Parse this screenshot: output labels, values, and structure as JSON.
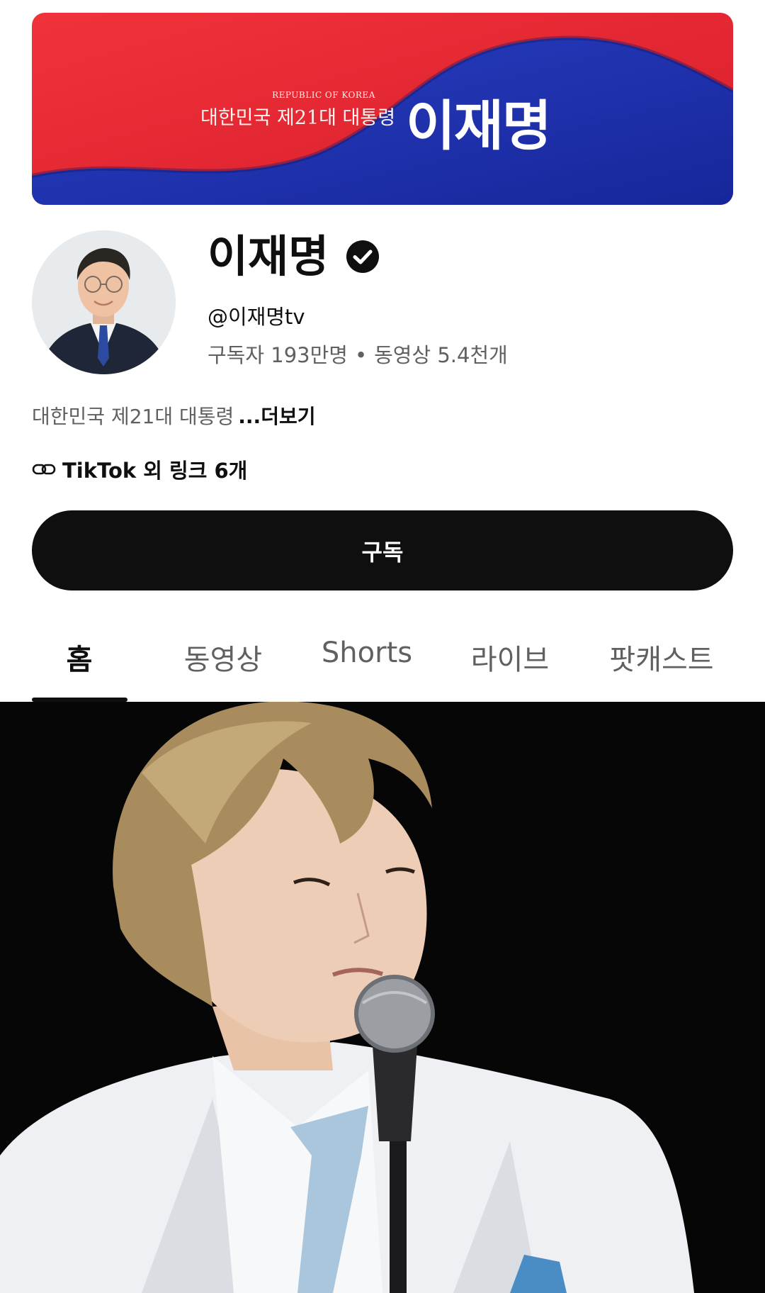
{
  "banner": {
    "small_text": "REPUBLIC OF KOREA",
    "subtitle": "대한민국 제21대 대통령",
    "name": "이재명",
    "colors": {
      "red": "#e8232f",
      "blue": "#1c2fa8"
    }
  },
  "channel": {
    "name": "이재명",
    "verified_icon": "check-circle-icon",
    "handle": "@이재명tv",
    "subscribers": "구독자 193만명",
    "separator": "•",
    "videos": "동영상 5.4천개",
    "description": "대한민국 제21대 대통령",
    "more_label": "...더보기",
    "links_label": "TikTok 외 링크 6개",
    "link_icon": "link-icon"
  },
  "subscribe": {
    "label": "구독"
  },
  "tabs": [
    {
      "label": "홈",
      "active": true
    },
    {
      "label": "동영상",
      "active": false
    },
    {
      "label": "Shorts",
      "active": false
    },
    {
      "label": "라이브",
      "active": false
    },
    {
      "label": "팟캐스트",
      "active": false
    }
  ]
}
